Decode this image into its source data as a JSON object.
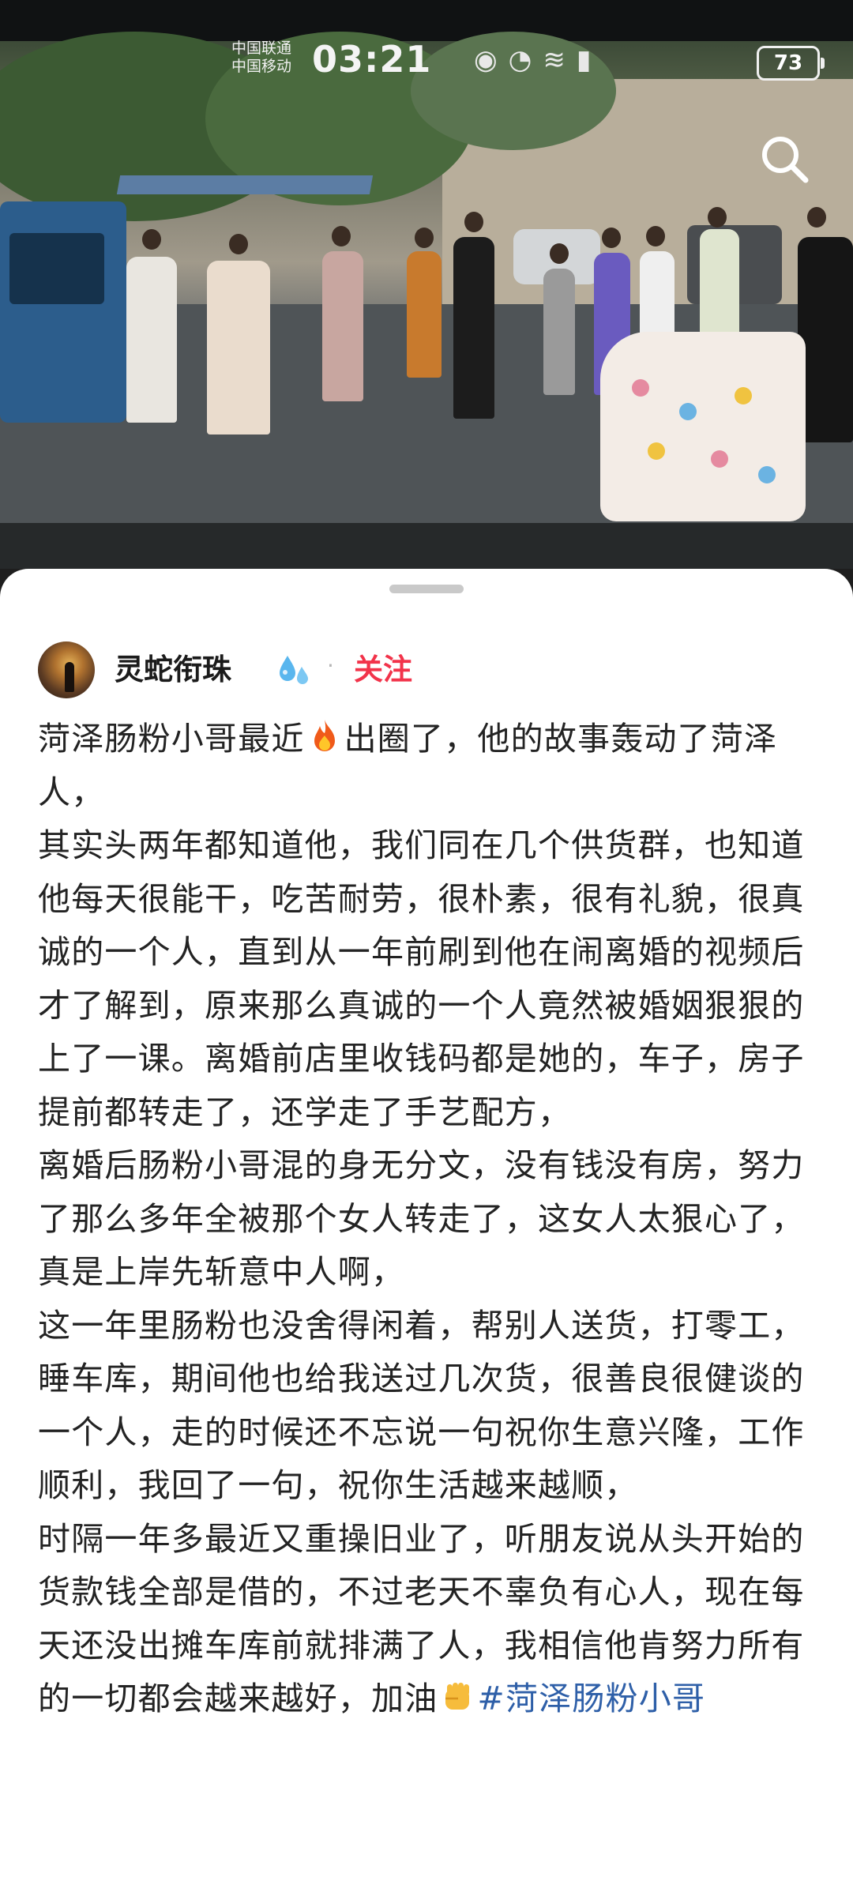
{
  "status_bar": {
    "carrier_1": "中国联通",
    "carrier_2": "中国移动",
    "time": "03:21",
    "battery": "73"
  },
  "author": {
    "name": "灵蛇衔珠",
    "separator": "·",
    "follow_label": "关注"
  },
  "post": {
    "p1_a": "菏泽肠粉小哥最近",
    "p1_b": "出圈了，他的故事轰动了菏泽人，",
    "p2": "其实头两年都知道他，我们同在几个供货群，也知道他每天很能干，吃苦耐劳，很朴素，很有礼貌，很真诚的一个人，直到从一年前刷到他在闹离婚的视频后才了解到，原来那么真诚的一个人竟然被婚姻狠狠的上了一课。离婚前店里收钱码都是她的，车子，房子提前都转走了，还学走了手艺配方，",
    "p3": "离婚后肠粉小哥混的身无分文，没有钱没有房，努力了那么多年全被那个女人转走了，这女人太狠心了，真是上岸先斩意中人啊，",
    "p4": "这一年里肠粉也没舍得闲着，帮别人送货，打零工，睡车库，期间他也给我送过几次货，很善良很健谈的一个人，走的时候还不忘说一句祝你生意兴隆，工作顺利，我回了一句，祝你生活越来越顺，",
    "p5": "时隔一年多最近又重操旧业了，听朋友说从头开始的货款钱全部是借的，不过老天不辜负有心人，现在每天还没出摊车库前就排满了人，我相信他肯努力所有的一切都会越来越好，加油",
    "hashtag": "#菏泽肠粉小哥"
  },
  "colors": {
    "follow": "#f2334a",
    "hashtag": "#2e5fa8",
    "text": "#232323"
  },
  "icons": [
    "search-icon",
    "fire-emoji",
    "droplets-emoji",
    "fist-emoji"
  ]
}
